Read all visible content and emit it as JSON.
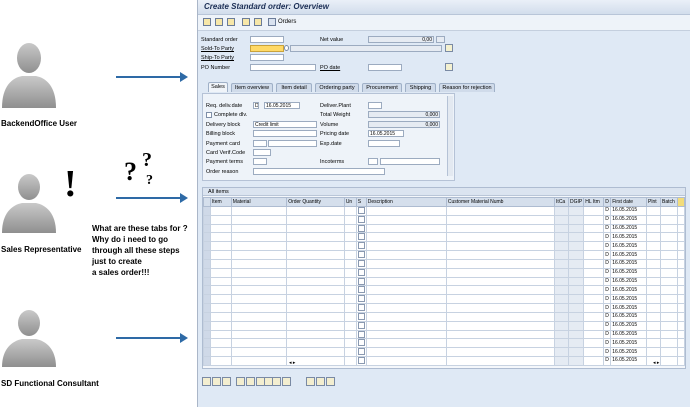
{
  "personas": [
    {
      "label": "BackendOffice User"
    },
    {
      "label": "Sales Representative"
    },
    {
      "label": "SD Functional Consultant"
    }
  ],
  "note_lines": [
    "What are these tabs for ?",
    "Why do i need to go",
    "through all these steps",
    "just to create",
    "a sales order!!!"
  ],
  "sap": {
    "title": "Create Standard order: Overview",
    "toolbar": {
      "orders_label": "Orders"
    },
    "header": {
      "standard_order_label": "Standard order",
      "net_value_label": "Net value",
      "net_value": "0,00",
      "sold_to_label": "Sold-To Party",
      "ship_to_label": "Ship-To Party",
      "po_number_label": "PO Number",
      "po_date_label": "PO date"
    },
    "tabs": [
      "Sales",
      "Item overview",
      "Item detail",
      "Ordering party",
      "Procurement",
      "Shipping",
      "Reason for rejection"
    ],
    "sales": {
      "req_deliv_date_label": "Req. deliv.date",
      "req_deliv_prefix": "D",
      "req_deliv_date": "16.05.2015",
      "deliver_plant_label": "Deliver.Plant",
      "complete_dlv_label": "Complete dlv.",
      "total_weight_label": "Total Weight",
      "total_weight": "0,000",
      "delivery_block_label": "Delivery block",
      "delivery_block_value": "Credit limit",
      "volume_label": "Volume",
      "volume": "0,000",
      "billing_block_label": "Billing block",
      "pricing_date_label": "Pricing date",
      "pricing_date": "16.05.2015",
      "payment_card_label": "Payment card",
      "exp_date_label": "Exp.date",
      "card_verif_label": "Card Verif.Code",
      "payment_terms_label": "Payment terms",
      "incoterms_label": "Incoterms",
      "order_reason_label": "Order reason"
    },
    "grid": {
      "title": "All items",
      "columns": [
        "Item",
        "Material",
        "Order Quantity",
        "Un",
        "S",
        "Description",
        "Customer Material Numb",
        "ItCa",
        "DGIP",
        "HL Itm",
        "D",
        "First date",
        "Plnt",
        "Batch"
      ],
      "row_prefix": "D",
      "row_date": "16.05.2015",
      "row_count": 18
    }
  },
  "colors": {
    "window_bg": "#dfe9f5",
    "required_field": "#ffd966",
    "arrow": "#2e6aa6"
  }
}
